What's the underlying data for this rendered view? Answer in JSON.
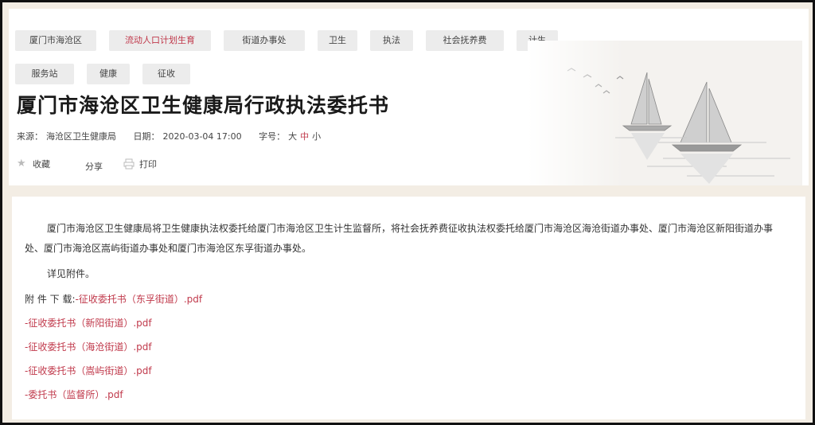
{
  "tags": [
    {
      "label": "厦门市海沧区",
      "active": false
    },
    {
      "label": "流动人口计划生育",
      "active": true
    },
    {
      "label": "街道办事处",
      "active": false
    },
    {
      "label": "卫生",
      "active": false
    },
    {
      "label": "执法",
      "active": false
    },
    {
      "label": "社会抚养费",
      "active": false
    },
    {
      "label": "计生",
      "active": false
    },
    {
      "label": "服务站",
      "active": false
    },
    {
      "label": "健康",
      "active": false
    },
    {
      "label": "征收",
      "active": false
    }
  ],
  "article": {
    "title": "厦门市海沧区卫生健康局行政执法委托书",
    "source_label": "来源：",
    "source_value": "海沧区卫生健康局",
    "date_label": "日期：",
    "date_value": "2020-03-04 17:00",
    "font_size_label": "字号：",
    "font_sizes": [
      "大",
      "中",
      "小"
    ],
    "selected_font_size": "中"
  },
  "actions": {
    "favorite_label": "收藏",
    "share_label": "分享",
    "print_label": "打印"
  },
  "content": {
    "paragraph": "厦门市海沧区卫生健康局将卫生健康执法权委托给厦门市海沧区卫生计生监督所，将社会抚养费征收执法权委托给厦门市海沧区海沧街道办事处、厦门市海沧区新阳街道办事处、厦门市海沧区嵩屿街道办事处和厦门市海沧区东孚街道办事处。",
    "detail": "详见附件。",
    "attachments_label": "附 件 下 载:",
    "attachments": [
      "-征收委托书（东孚街道）.pdf",
      "-征收委托书（新阳街道）.pdf",
      "-征收委托书（海沧街道）.pdf",
      "-征收委托书（嵩屿街道）.pdf",
      "-委托书（监督所）.pdf"
    ]
  },
  "colors": {
    "accent": "#c0394b",
    "tag_bg": "#ececec",
    "page_bg": "#f3ede4"
  }
}
